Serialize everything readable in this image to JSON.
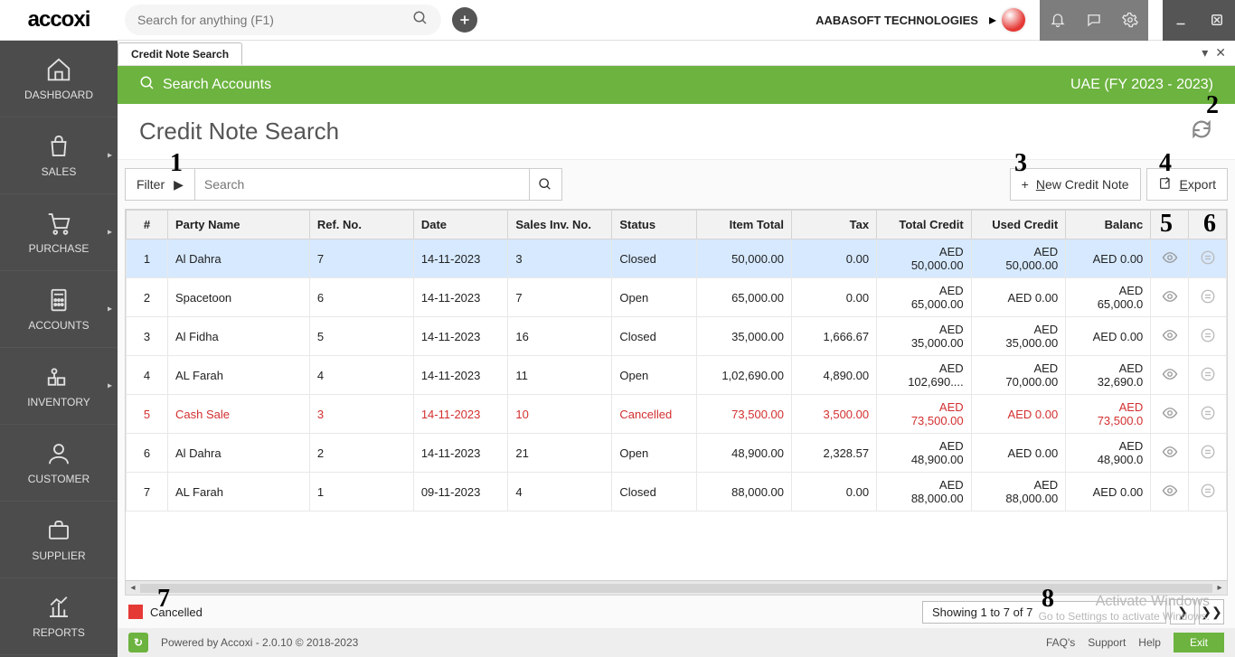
{
  "header": {
    "logo": "accoxi",
    "search_placeholder": "Search for anything (F1)",
    "company": "AABASOFT TECHNOLOGIES",
    "company_chev": "▸"
  },
  "sidebar": {
    "items": [
      {
        "label": "DASHBOARD",
        "icon": "home"
      },
      {
        "label": "SALES",
        "icon": "bag",
        "chev": true
      },
      {
        "label": "PURCHASE",
        "icon": "cart",
        "chev": true
      },
      {
        "label": "ACCOUNTS",
        "icon": "calc",
        "chev": true
      },
      {
        "label": "INVENTORY",
        "icon": "inventory",
        "chev": true
      },
      {
        "label": "CUSTOMER",
        "icon": "user"
      },
      {
        "label": "SUPPLIER",
        "icon": "briefcase"
      },
      {
        "label": "REPORTS",
        "icon": "chart"
      }
    ]
  },
  "tab": {
    "title": "Credit Note Search"
  },
  "greenbar": {
    "title": "Search Accounts",
    "fy": "UAE (FY 2023 - 2023)"
  },
  "page_title": "Credit Note Search",
  "toolbar": {
    "filter_label": "Filter",
    "search_placeholder": "Search",
    "new_label_prefix": "N",
    "new_label_rest": "ew Credit Note",
    "export_label_prefix": "E",
    "export_label_rest": "xport"
  },
  "annotations": {
    "n1": "1",
    "n2": "2",
    "n3": "3",
    "n4": "4",
    "n5": "5",
    "n6": "6",
    "n7": "7",
    "n8": "8"
  },
  "table": {
    "headers": [
      "#",
      "Party Name",
      "Ref. No.",
      "Date",
      "Sales Inv. No.",
      "Status",
      "Item Total",
      "Tax",
      "Total Credit",
      "Used Credit",
      "Balanc"
    ],
    "rows": [
      {
        "n": "1",
        "party": "Al Dahra",
        "ref": "7",
        "date": "14-11-2023",
        "inv": "3",
        "status": "Closed",
        "item": "50,000.00",
        "tax": "0.00",
        "total": "AED 50,000.00",
        "used": "AED 50,000.00",
        "bal": "AED 0.00",
        "selected": true
      },
      {
        "n": "2",
        "party": "Spacetoon",
        "ref": "6",
        "date": "14-11-2023",
        "inv": "7",
        "status": "Open",
        "item": "65,000.00",
        "tax": "0.00",
        "total": "AED 65,000.00",
        "used": "AED 0.00",
        "bal": "AED 65,000.0"
      },
      {
        "n": "3",
        "party": "Al Fidha",
        "ref": "5",
        "date": "14-11-2023",
        "inv": "16",
        "status": "Closed",
        "item": "35,000.00",
        "tax": "1,666.67",
        "total": "AED 35,000.00",
        "used": "AED 35,000.00",
        "bal": "AED 0.00"
      },
      {
        "n": "4",
        "party": "AL Farah",
        "ref": "4",
        "date": "14-11-2023",
        "inv": "11",
        "status": "Open",
        "item": "1,02,690.00",
        "tax": "4,890.00",
        "total": "AED 102,690....",
        "used": "AED 70,000.00",
        "bal": "AED 32,690.0"
      },
      {
        "n": "5",
        "party": "Cash Sale",
        "ref": "3",
        "date": "14-11-2023",
        "inv": "10",
        "status": "Cancelled",
        "item": "73,500.00",
        "tax": "3,500.00",
        "total": "AED 73,500.00",
        "used": "AED 0.00",
        "bal": "AED 73,500.0",
        "cancelled": true
      },
      {
        "n": "6",
        "party": "Al Dahra",
        "ref": "2",
        "date": "14-11-2023",
        "inv": "21",
        "status": "Open",
        "item": "48,900.00",
        "tax": "2,328.57",
        "total": "AED 48,900.00",
        "used": "AED 0.00",
        "bal": "AED 48,900.0"
      },
      {
        "n": "7",
        "party": "AL Farah",
        "ref": "1",
        "date": "09-11-2023",
        "inv": "4",
        "status": "Closed",
        "item": "88,000.00",
        "tax": "0.00",
        "total": "AED 88,000.00",
        "used": "AED 88,000.00",
        "bal": "AED 0.00"
      }
    ]
  },
  "legend": {
    "cancelled": "Cancelled"
  },
  "pager": {
    "info": "Showing 1 to 7 of 7"
  },
  "footer": {
    "powered": "Powered by Accoxi - 2.0.10 © 2018-2023",
    "faq": "FAQ's",
    "support": "Support",
    "help": "Help",
    "exit": "Exit"
  },
  "watermark": {
    "title": "Activate Windows",
    "sub": "Go to Settings to activate Windows."
  }
}
